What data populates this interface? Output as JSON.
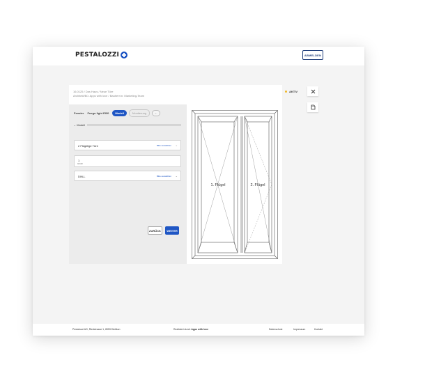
{
  "header": {
    "logo": "PESTALOZZI",
    "logout_label": "ABMELDEN"
  },
  "card": {
    "breadcrumb": "16.0125 / Das Haus / Neue Türe",
    "subline": "Architekt/Bü: Apps with love / Bauherr:in: Marketing-Team",
    "status": "AKTIV",
    "tabs": {
      "t1": "Fenster",
      "t2": "Fuego light EI30",
      "active": "Modell",
      "inactive": "Montierung"
    },
    "section_title": "Modell",
    "fields": [
      {
        "value": "2 Flügelige Türe",
        "action": "Bitte auswählen"
      },
      {
        "value": "1",
        "caption": "Anzahl"
      },
      {
        "value": "DIN-L",
        "action": "Bitte auswählen"
      }
    ],
    "back_label": "ZURÜCK",
    "next_label": "WEITER"
  },
  "preview": {
    "leaf1": "1. Flügel",
    "leaf2": "2. Flügel"
  },
  "footer": {
    "address": "Pestalozzi AG, Riedstrasse 1, 8953 Dietikon",
    "credit_prefix": "Realisiert durch",
    "credit_brand": "Apps with love",
    "privacy": "Datenschutz",
    "imprint": "Impressum",
    "contact": "Kontakt"
  },
  "colors": {
    "primary": "#1f56c4",
    "status": "#f0b828"
  }
}
